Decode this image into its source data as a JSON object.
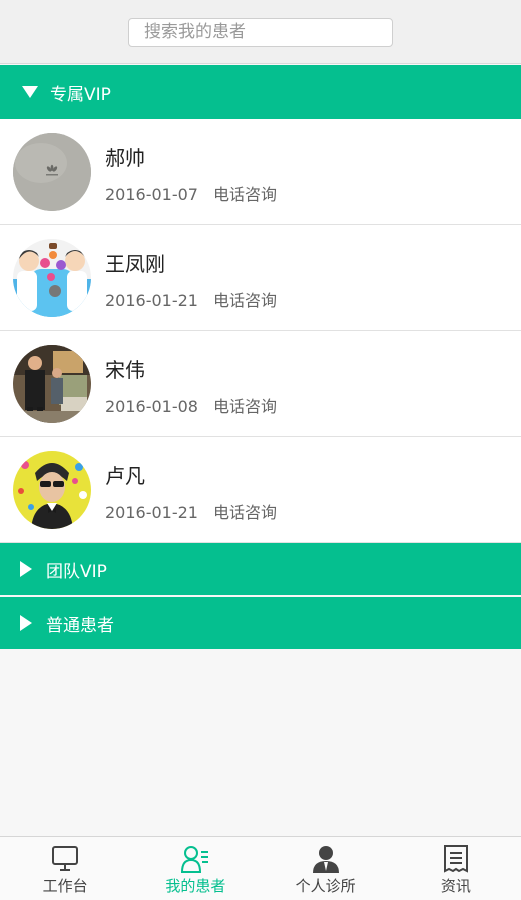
{
  "search": {
    "placeholder": "搜索我的患者"
  },
  "groups": [
    {
      "label": "专属VIP",
      "expanded": true
    },
    {
      "label": "团队VIP",
      "expanded": false
    },
    {
      "label": "普通患者",
      "expanded": false
    }
  ],
  "patients": [
    {
      "name": "郝帅",
      "date": "2016-01-07",
      "consult_type": "电话咨询",
      "avatar": "grey-device-photo"
    },
    {
      "name": "王凤刚",
      "date": "2016-01-21",
      "consult_type": "电话咨询",
      "avatar": "cartoon-doctors"
    },
    {
      "name": "宋伟",
      "date": "2016-01-08",
      "consult_type": "电话咨询",
      "avatar": "event-photo"
    },
    {
      "name": "卢凡",
      "date": "2016-01-21",
      "consult_type": "电话咨询",
      "avatar": "portrait-illustration"
    }
  ],
  "tabs": [
    {
      "label": "工作台",
      "icon": "monitor-icon",
      "active": false
    },
    {
      "label": "我的患者",
      "icon": "patients-icon",
      "active": true
    },
    {
      "label": "个人诊所",
      "icon": "doctor-icon",
      "active": false
    },
    {
      "label": "资讯",
      "icon": "news-icon",
      "active": false
    }
  ],
  "colors": {
    "accent": "#05bf8f",
    "text": "#222222",
    "muted": "#666666"
  }
}
